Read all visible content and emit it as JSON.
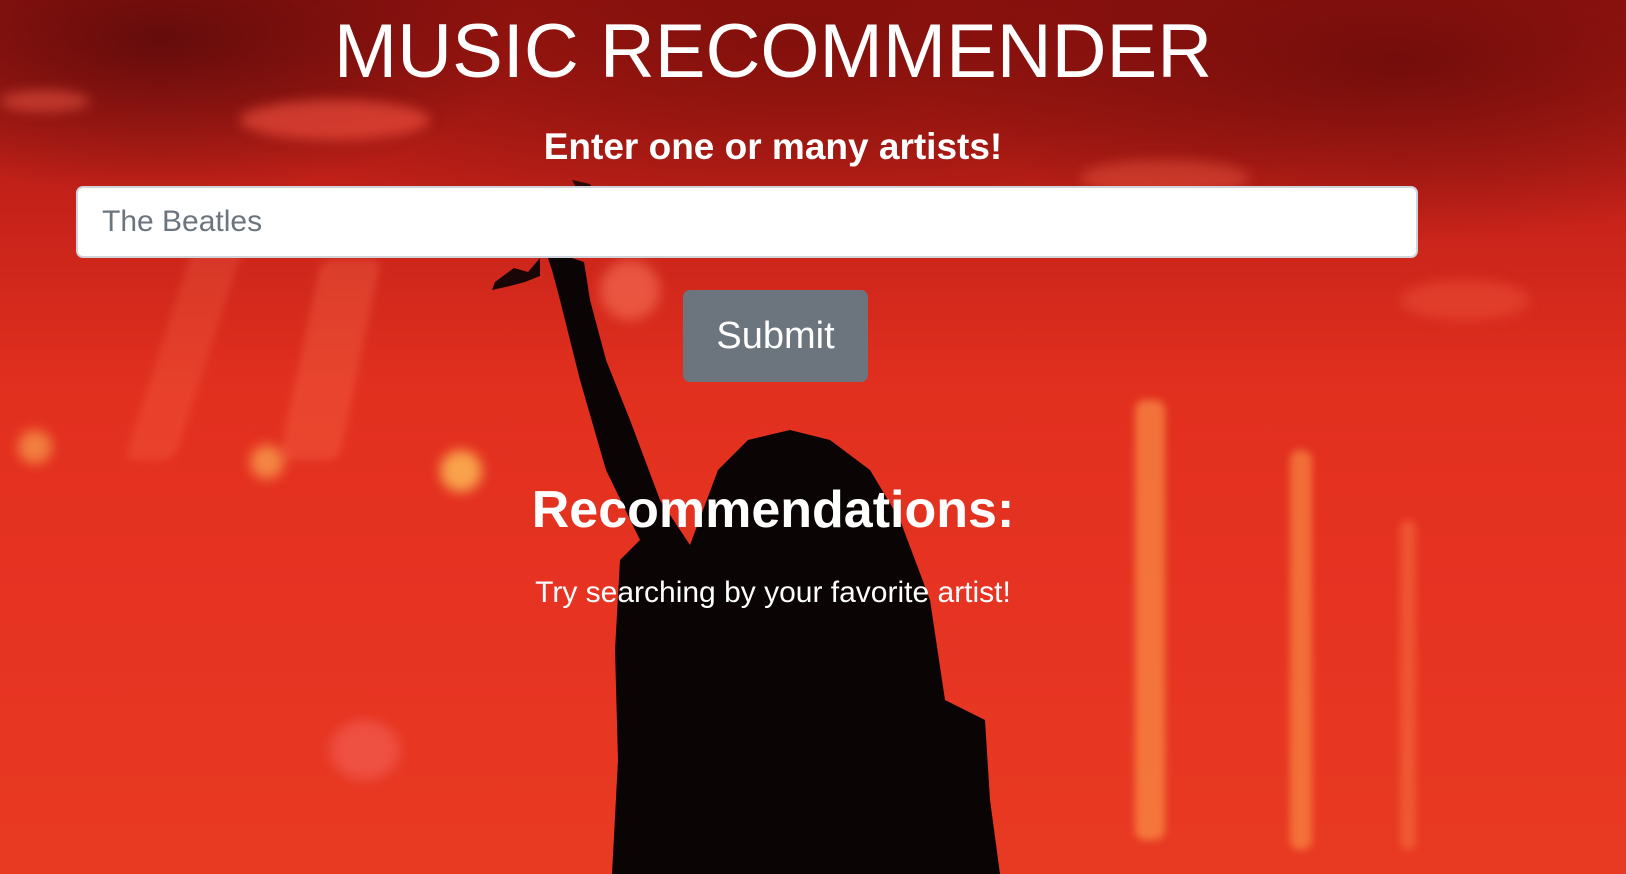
{
  "page": {
    "title": "MUSIC RECOMMENDER",
    "subtitle": "Enter one or many artists!"
  },
  "search": {
    "value": "",
    "placeholder": "The Beatles"
  },
  "actions": {
    "submit_label": "Submit"
  },
  "recommendations": {
    "heading": "Recommendations:",
    "empty_hint": "Try searching by your favorite artist!"
  },
  "colors": {
    "background_primary": "#e63322",
    "button": "#6c757d",
    "text": "#ffffff"
  }
}
